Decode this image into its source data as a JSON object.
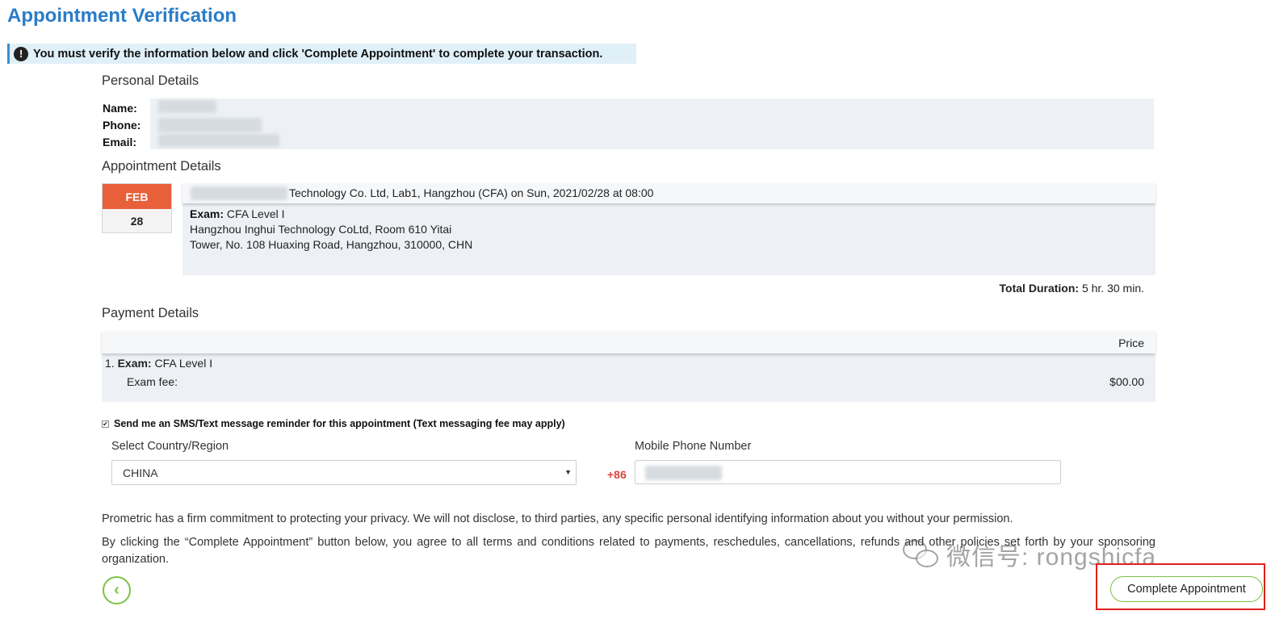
{
  "page": {
    "title": "Appointment Verification",
    "alert_icon": "!",
    "alert_text": "You must verify the information below and click 'Complete Appointment' to complete your transaction."
  },
  "personal": {
    "heading": "Personal Details",
    "name_label": "Name:",
    "phone_label": "Phone:",
    "email_label": "Email:"
  },
  "appointment": {
    "heading": "Appointment Details",
    "month": "FEB",
    "day": "28",
    "location_line": "Technology Co. Ltd, Lab1, Hangzhou (CFA) on Sun, 2021/02/28 at 08:00",
    "exam_label": "Exam:",
    "exam_value": " CFA Level I",
    "address_line1": "Hangzhou Inghui Technology CoLtd, Room 610 Yitai",
    "address_line2": "Tower, No. 108 Huaxing Road, Hangzhou, 310000, CHN",
    "duration_label": "Total Duration:",
    "duration_value": " 5 hr. 30 min."
  },
  "payment": {
    "heading": "Payment Details",
    "price_header": "Price",
    "item_number": "1. ",
    "item_label": "Exam:",
    "item_value": " CFA Level I",
    "fee_label": "Exam fee:",
    "fee_amount": "$00.00"
  },
  "sms": {
    "checked": true,
    "check_glyph": "✔",
    "label": "Send me an SMS/Text message reminder for this appointment (Text messaging fee may apply)",
    "country_label": "Select Country/Region",
    "country_value": "CHINA",
    "dropdown_glyph": "▼",
    "phone_label": "Mobile Phone Number",
    "phone_prefix": "+86"
  },
  "legal": {
    "privacy": "Prometric has a firm commitment to protecting your privacy. We will not disclose, to third parties, any specific personal identifying information about you without your permission.",
    "terms": "By clicking the “Complete Appointment” button below, you agree to all terms and conditions related to payments, reschedules, cancellations, refunds and other policies set forth by your sponsoring organization."
  },
  "actions": {
    "back_glyph": "‹",
    "complete_label": "Complete Appointment"
  },
  "watermark": {
    "text": "微信号: rongshicfa",
    "icon": "wechat-icon"
  },
  "colors": {
    "title_blue": "#2a7cc7",
    "calendar_orange": "#e8603a",
    "button_green": "#7cc243",
    "prefix_red": "#d9463e",
    "highlight_red": "#e0201c"
  }
}
